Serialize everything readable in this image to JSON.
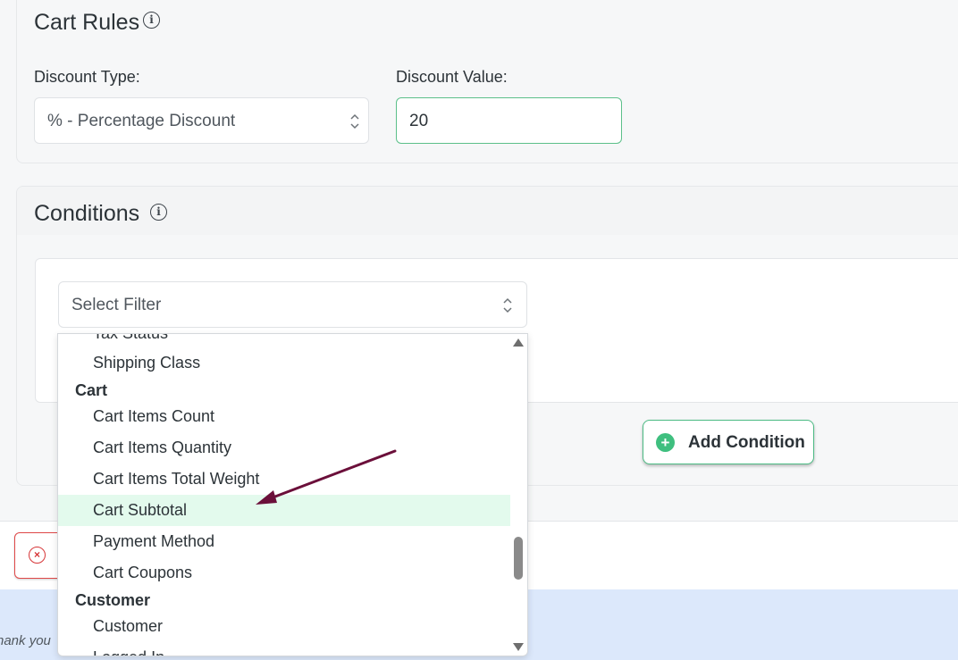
{
  "cart_rules": {
    "title": "Cart Rules",
    "info_icon": "info-icon",
    "discount_type_label": "Discount Type:",
    "discount_type_value": "% - Percentage Discount",
    "discount_value_label": "Discount Value:",
    "discount_value": "20"
  },
  "conditions": {
    "title": "Conditions",
    "info_icon": "info-icon",
    "filter_placeholder": "Select Filter",
    "add_condition_label": "Add Condition"
  },
  "dropdown": {
    "partial_top_item": "Tax Status",
    "items": [
      {
        "type": "option",
        "label": "Shipping Class"
      },
      {
        "type": "group",
        "label": "Cart"
      },
      {
        "type": "option",
        "label": "Cart Items Count"
      },
      {
        "type": "option",
        "label": "Cart Items Quantity"
      },
      {
        "type": "option",
        "label": "Cart Items Total Weight"
      },
      {
        "type": "option",
        "label": "Cart Subtotal",
        "highlighted": true
      },
      {
        "type": "option",
        "label": "Payment Method"
      },
      {
        "type": "option",
        "label": "Cart Coupons"
      },
      {
        "type": "group",
        "label": "Customer"
      },
      {
        "type": "option",
        "label": "Customer"
      },
      {
        "type": "option",
        "label": "Logged In"
      }
    ]
  },
  "footer": {
    "text": "hank you"
  },
  "colors": {
    "accent_green": "#3fbf7f",
    "highlight_bg": "#e3faed",
    "error_red": "#d63638",
    "annotation_arrow": "#6b0f3a"
  }
}
